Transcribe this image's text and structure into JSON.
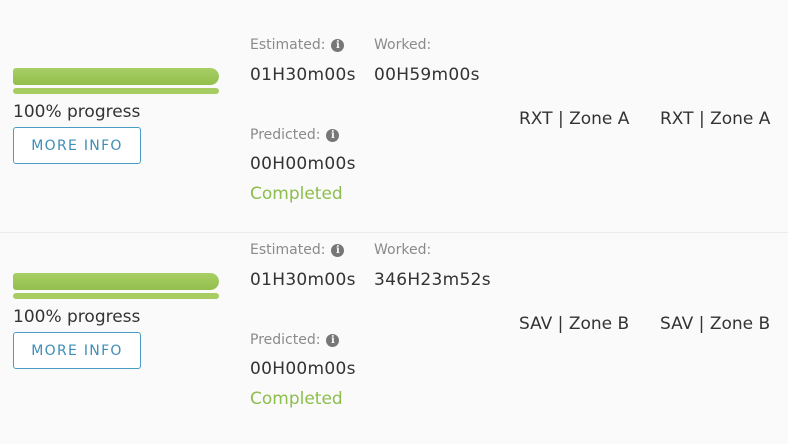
{
  "rows": [
    {
      "progress": 1.0,
      "progress_text": "100% progress",
      "more_info_label": "MORE INFO",
      "estimated_label": "Estimated:",
      "estimated_value": "01H30m00s",
      "worked_label": "Worked:",
      "worked_value": "00H59m00s",
      "predicted_label": "Predicted:",
      "predicted_value": "00H00m00s",
      "status": "Completed",
      "location_1": "RXT | Zone A",
      "location_2": "RXT | Zone A"
    },
    {
      "progress": 1.0,
      "progress_text": "100% progress",
      "more_info_label": "MORE INFO",
      "estimated_label": "Estimated:",
      "estimated_value": "01H30m00s",
      "worked_label": "Worked:",
      "worked_value": "346H23m52s",
      "predicted_label": "Predicted:",
      "predicted_value": "00H00m00s",
      "status": "Completed",
      "location_1": "SAV | Zone B",
      "location_2": "SAV | Zone B"
    }
  ],
  "icons": {
    "info": "info-icon"
  },
  "colors": {
    "progress_fill": "#9bc656",
    "button_accent": "#4a9cc4",
    "status_completed": "#8cbd4d"
  }
}
